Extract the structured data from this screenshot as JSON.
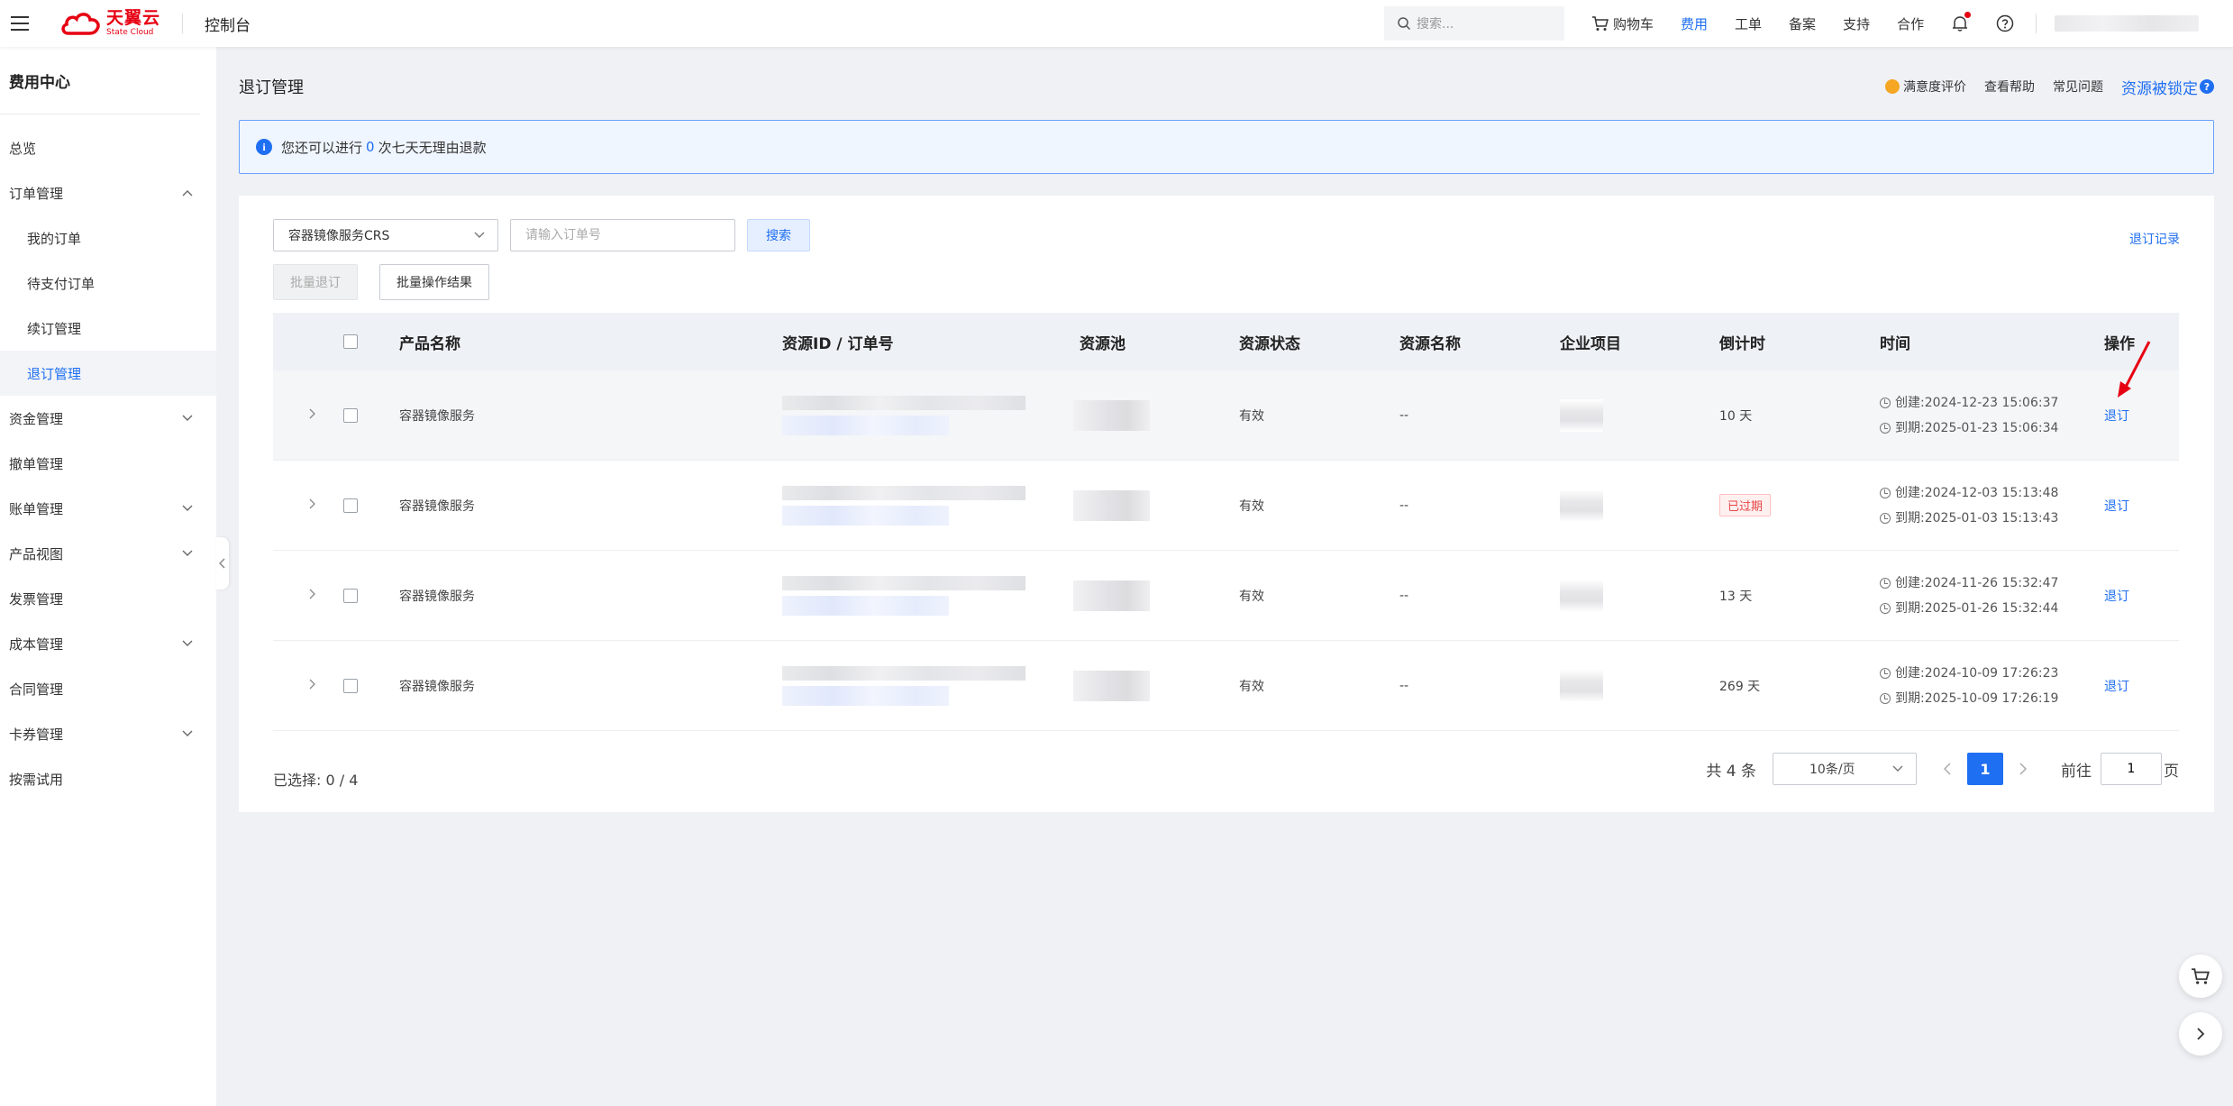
{
  "header": {
    "logo_cn": "天翼云",
    "logo_en": "State Cloud",
    "console": "控制台",
    "search_placeholder": "搜索...",
    "nav": [
      "购物车",
      "费用",
      "工单",
      "备案",
      "支持",
      "合作"
    ],
    "active_nav": "费用"
  },
  "sidebar": {
    "title": "费用中心",
    "items": [
      {
        "label": "总览",
        "level": 1,
        "expand": "none"
      },
      {
        "label": "订单管理",
        "level": 1,
        "expand": "up"
      },
      {
        "label": "我的订单",
        "level": 2,
        "expand": "none"
      },
      {
        "label": "待支付订单",
        "level": 2,
        "expand": "none"
      },
      {
        "label": "续订管理",
        "level": 2,
        "expand": "none"
      },
      {
        "label": "退订管理",
        "level": 2,
        "expand": "none",
        "active": true
      },
      {
        "label": "资金管理",
        "level": 1,
        "expand": "down"
      },
      {
        "label": "撤单管理",
        "level": 1,
        "expand": "none"
      },
      {
        "label": "账单管理",
        "level": 1,
        "expand": "down"
      },
      {
        "label": "产品视图",
        "level": 1,
        "expand": "down"
      },
      {
        "label": "发票管理",
        "level": 1,
        "expand": "none"
      },
      {
        "label": "成本管理",
        "level": 1,
        "expand": "down"
      },
      {
        "label": "合同管理",
        "level": 1,
        "expand": "none"
      },
      {
        "label": "卡券管理",
        "level": 1,
        "expand": "down"
      },
      {
        "label": "按需试用",
        "level": 1,
        "expand": "none"
      }
    ]
  },
  "page": {
    "title": "退订管理",
    "links": {
      "rating": "满意度评价",
      "help": "查看帮助",
      "faq": "常见问题",
      "locked": "资源被锁定"
    },
    "notice": {
      "prefix": "您还可以进行",
      "count": "0",
      "suffix": "次七天无理由退款"
    }
  },
  "filter": {
    "product": "容器镜像服务CRS",
    "order_placeholder": "请输入订单号",
    "search_btn": "搜索",
    "record_link": "退订记录",
    "batch_unsubscribe": "批量退订",
    "batch_result": "批量操作结果"
  },
  "table": {
    "columns": [
      "产品名称",
      "资源ID / 订单号",
      "资源池",
      "资源状态",
      "资源名称",
      "企业项目",
      "倒计时",
      "时间",
      "操作"
    ],
    "rows": [
      {
        "product": "容器镜像服务",
        "status": "有效",
        "name": "--",
        "countdown": "10 天",
        "expired": false,
        "created": "创建:2024-12-23 15:06:37",
        "expires": "到期:2025-01-23 15:06:34",
        "action": "退订"
      },
      {
        "product": "容器镜像服务",
        "status": "有效",
        "name": "--",
        "countdown": "已过期",
        "expired": true,
        "created": "创建:2024-12-03 15:13:48",
        "expires": "到期:2025-01-03 15:13:43",
        "action": "退订"
      },
      {
        "product": "容器镜像服务",
        "status": "有效",
        "name": "--",
        "countdown": "13 天",
        "expired": false,
        "created": "创建:2024-11-26 15:32:47",
        "expires": "到期:2025-01-26 15:32:44",
        "action": "退订"
      },
      {
        "product": "容器镜像服务",
        "status": "有效",
        "name": "--",
        "countdown": "269 天",
        "expired": false,
        "created": "创建:2024-10-09 17:26:23",
        "expires": "到期:2025-10-09 17:26:19",
        "action": "退订"
      }
    ]
  },
  "footer": {
    "selected": "已选择: 0 / 4",
    "total": "共 4 条",
    "page_size": "10条/页",
    "current_page": "1",
    "goto_label": "前往",
    "goto_value": "1",
    "page_suffix": "页"
  },
  "colors": {
    "accent": "#1f6ff2",
    "brand": "#e60012",
    "expired": "#e84545"
  }
}
